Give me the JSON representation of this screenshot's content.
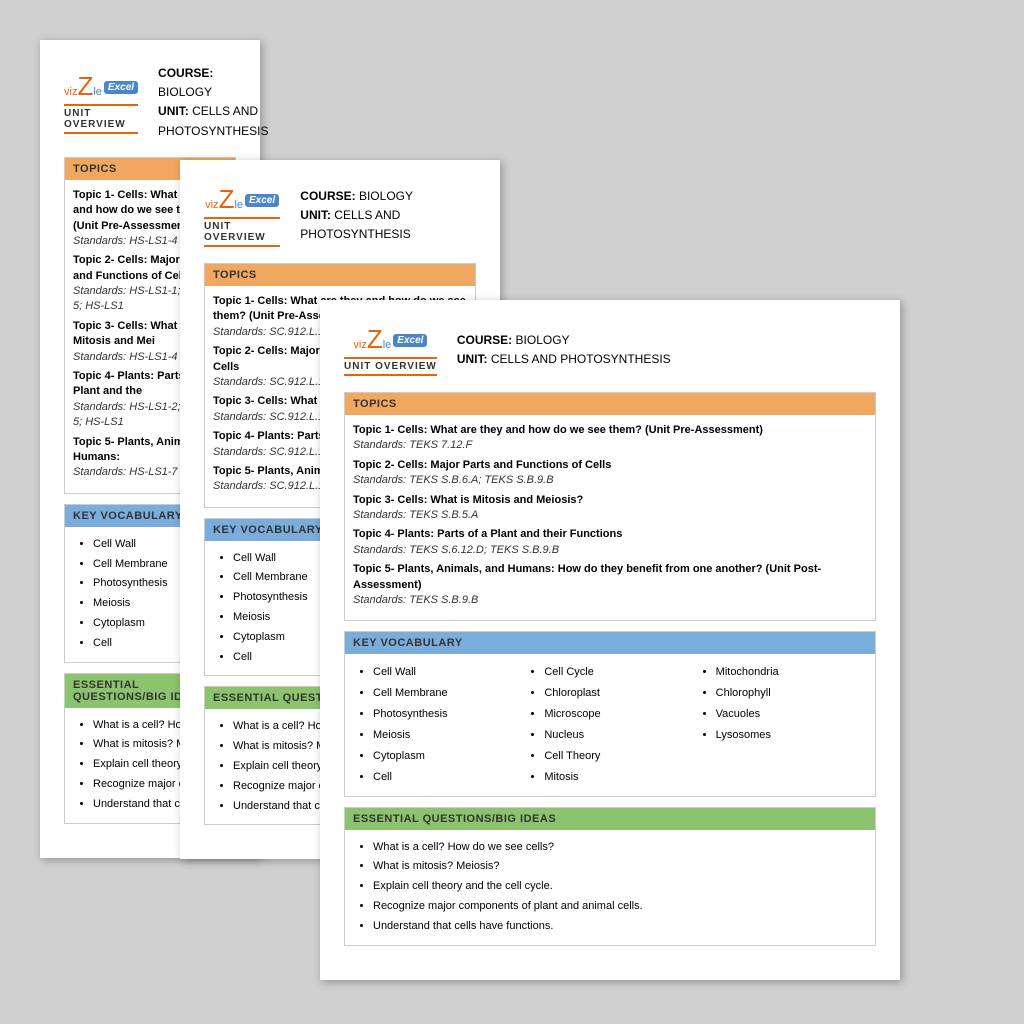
{
  "app": {
    "title": "Vizzle Unit Overview"
  },
  "shared": {
    "logo_viz": "viz",
    "logo_z": "Z",
    "logo_le": "le",
    "logo_excel": "Excel",
    "unit_overview": "UNIT OVERVIEW",
    "course_label": "COURSE:",
    "course_value": "Biology",
    "unit_label": "UNIT:",
    "unit_value": "Cells and Photosynthesis",
    "topics_header": "TOPICS",
    "vocab_header": "KEY VOCABULARY",
    "essential_header": "ESSENTIAL QUESTIONS/BIG IDEAS"
  },
  "page1": {
    "topics": [
      {
        "title": "Topic 1- Cells:  What are they and how do we see them? (Unit Pre-Assessment)",
        "standards": "Standards:  HS-LS1-4"
      },
      {
        "title": "Topic 2- Cells:  Major Parts and Functions of Cells",
        "standards": "Standards:  HS-LS1-1; HS-LS1-5; HS-LS1"
      },
      {
        "title": "Topic 3- Cells:  What is Mitosis and Mei",
        "standards": "Standards:  HS-LS1-4"
      },
      {
        "title": "Topic 4- Plants:  Parts of a Plant and the",
        "standards": "Standards:  HS-LS1-2; HS-LS1-5; HS-LS1"
      },
      {
        "title": "Topic 5- Plants, Animals, and Humans:",
        "standards": "Standards:  HS-LS1-7"
      }
    ],
    "vocab": [
      "Cell Wall",
      "Cell Membrane",
      "Photosynthesis",
      "Meiosis",
      "Cytoplasm",
      "Cell"
    ],
    "essential": [
      "What is a cell? How do",
      "What is mitosis? Meiosi",
      "Explain cell theory and",
      "Recognize major compo",
      "Understand that cells h"
    ]
  },
  "page2": {
    "topics": [
      {
        "title": "Topic 1- Cells:  What are they and how do we see them? (Unit Pre-Assessment)",
        "standards": "Standards:  SC.912.L.14.1"
      },
      {
        "title": "Topic 2- Cells:  Major Parts and Functions of Cells",
        "standards": "Standards:  SC.912.L.14.2; SC.912.L.14.3; SC"
      },
      {
        "title": "Topic 3- Cells:  What is Mitosis and Meiosis?",
        "standards": "Standards:  SC.912.L.16.14; SC.912.L.16.16"
      },
      {
        "title": "Topic 4- Plants:  Parts of a Plant and their Fu",
        "standards": "Standards:  SC.912.L.14.7; SC.912.L.18.7; SC"
      },
      {
        "title": "Topic 5- Plants, Animals, and Humans:  How",
        "standards": "Standards:  SC.912.L.18.9"
      }
    ],
    "vocab": [
      "Cell Wall",
      "Cell Membrane",
      "Photosynthesis",
      "Meiosis",
      "Cytoplasm",
      "Cell"
    ],
    "essential": [
      "What is a cell? How do we see",
      "What is mitosis? Meiosis?",
      "Explain cell theory and the cel",
      "Recognize major compo",
      "Understand that cells have fun"
    ]
  },
  "page3": {
    "topics": [
      {
        "title": "Topic 1- Cells:  What are they and how do we see them? (Unit Pre-Assessment)",
        "standards": "Standards:  TEKS 7.12.F"
      },
      {
        "title": "Topic 2- Cells:  Major Parts and Functions of Cells",
        "standards": "Standards:  TEKS S.B.6.A; TEKS S.B.9.B"
      },
      {
        "title": "Topic 3- Cells:  What is Mitosis and Meiosis?",
        "standards": "Standards:  TEKS S.B.5.A"
      },
      {
        "title": "Topic 4- Plants:  Parts of a Plant and their Functions",
        "standards": "Standards:  TEKS S.6.12.D; TEKS S.B.9.B"
      },
      {
        "title": "Topic 5- Plants, Animals, and Humans:  How do they benefit from one another? (Unit Post-Assessment)",
        "standards": "Standards:  TEKS S.B.9.B"
      }
    ],
    "vocab_col1": [
      "Cell Wall",
      "Cell Membrane",
      "Photosynthesis",
      "Meiosis",
      "Cytoplasm",
      "Cell"
    ],
    "vocab_col2": [
      "Cell Cycle",
      "Chloroplast",
      "Microscope",
      "Nucleus",
      "Cell Theory",
      "Mitosis"
    ],
    "vocab_col3": [
      "Mitochondria",
      "Chlorophyll",
      "Vacuoles",
      "Lysosomes"
    ],
    "essential": [
      "What is a cell? How do we see cells?",
      "What is mitosis? Meiosis?",
      "Explain cell theory and the cell cycle.",
      "Recognize major components of plant and animal cells.",
      "Understand that cells have functions."
    ]
  }
}
